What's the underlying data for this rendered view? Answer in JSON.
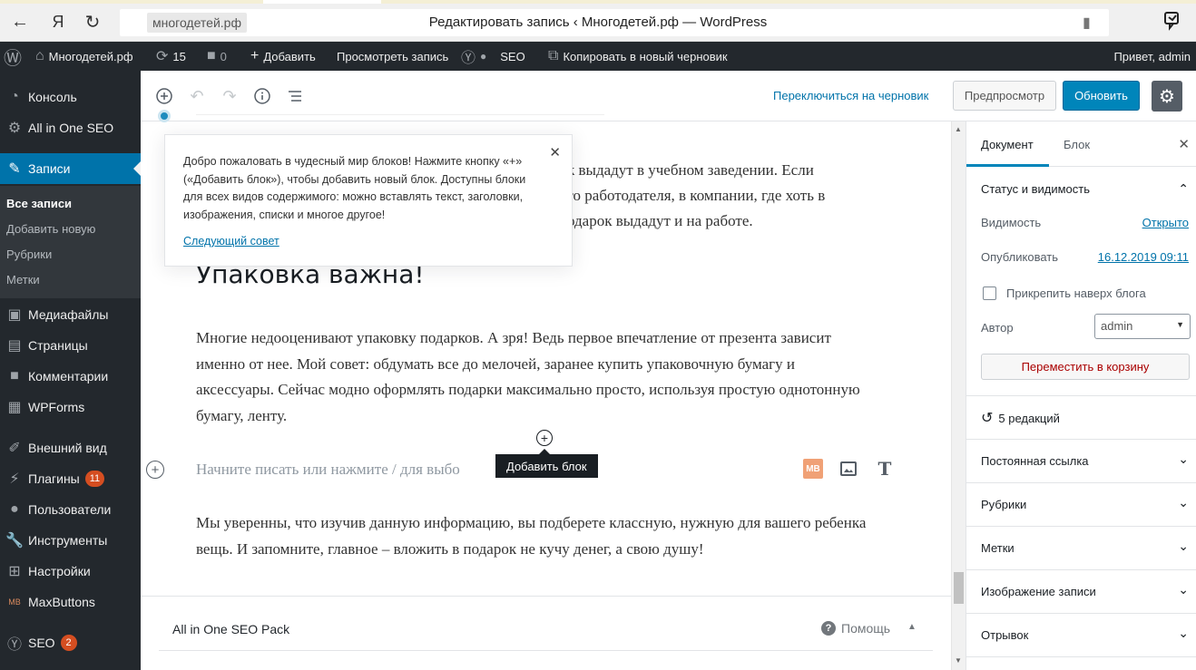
{
  "browser": {
    "back_icon": "arrow-left",
    "yandex_label": "Я",
    "reload_icon": "reload",
    "domain": "многодетей.рф",
    "page_title": "Редактировать запись ‹ Многодетей.рф — WordPress"
  },
  "adminbar": {
    "site_name": "Многодетей.рф",
    "updates_count": "15",
    "comments_count": "0",
    "add_label": "Добавить",
    "view_post_label": "Просмотреть запись",
    "seo_label": "SEO",
    "copy_draft_label": "Копировать в новый черновик",
    "greeting": "Привет, admin"
  },
  "sidebar": {
    "items": [
      {
        "label": "Консоль",
        "icon": "dashboard-icon"
      },
      {
        "label": "All in One SEO",
        "icon": "gear-icon"
      },
      {
        "label": "Записи",
        "icon": "pin-icon"
      },
      {
        "label": "Медиафайлы",
        "icon": "media-icon"
      },
      {
        "label": "Страницы",
        "icon": "pages-icon"
      },
      {
        "label": "Комментарии",
        "icon": "comment-icon"
      },
      {
        "label": "WPForms",
        "icon": "forms-icon"
      },
      {
        "label": "Внешний вид",
        "icon": "brush-icon"
      },
      {
        "label": "Плагины",
        "icon": "plugin-icon",
        "badge": "11"
      },
      {
        "label": "Пользователи",
        "icon": "user-icon"
      },
      {
        "label": "Инструменты",
        "icon": "wrench-icon"
      },
      {
        "label": "Настройки",
        "icon": "settings-icon"
      },
      {
        "label": "MaxButtons",
        "icon": "mb-icon"
      },
      {
        "label": "SEO",
        "icon": "yoast-icon",
        "badge": "2"
      }
    ],
    "sub_items": [
      "Все записи",
      "Добавить новую",
      "Рубрики",
      "Метки"
    ]
  },
  "toolbar": {
    "switch_draft": "Переключиться на черновик",
    "preview": "Предпросмотр",
    "update": "Обновить"
  },
  "tip": {
    "text": "Добро пожаловать в чудесный мир блоков! Нажмите кнопку «+» («Добавить блок»), чтобы добавить новый блок. Доступны блоки для всех видов содержимого: можно вставлять текст, заголовки, изображения, списки и многое другое!",
    "next_tip": "Следующий совет"
  },
  "content": {
    "partial_lines": [
      "к выдадут в учебном заведении. Если",
      "го работодателя, в компании, где хоть в",
      "одарок выдадут и на работе."
    ],
    "heading": "Упаковка важна!",
    "paragraph1": "Многие недооценивают упаковку подарков. А зря! Ведь первое впечатление от презента зависит именно от нее. Мой совет: обдумать все до мелочей, заранее купить упаковочную бумагу и аксессуары. Сейчас модно оформлять подарки максимально просто, используя простую однотонную бумагу, ленту.",
    "placeholder": "Начните писать или нажмите / для выбо",
    "tooltip": "Добавить блок",
    "mb_icon_label": "MB",
    "paragraph2": "Мы уверенны, что изучив данную информацию, вы подберете классную, нужную для вашего ребенка вещь. И запомните, главное – вложить в подарок не кучу денег, а свою душу!"
  },
  "seo_pack": {
    "title": "All in One SEO Pack",
    "help": "Помощь"
  },
  "panel": {
    "tab_document": "Документ",
    "tab_block": "Блок",
    "status_title": "Статус и видимость",
    "visibility_label": "Видимость",
    "visibility_value": "Открыто",
    "publish_label": "Опубликовать",
    "publish_value": "16.12.2019 09:11",
    "stick_label": "Прикрепить наверх блога",
    "author_label": "Автор",
    "author_value": "admin",
    "trash": "Переместить в корзину",
    "revisions": "5 редакций",
    "sections": [
      "Постоянная ссылка",
      "Рубрики",
      "Метки",
      "Изображение записи",
      "Отрывок"
    ]
  }
}
